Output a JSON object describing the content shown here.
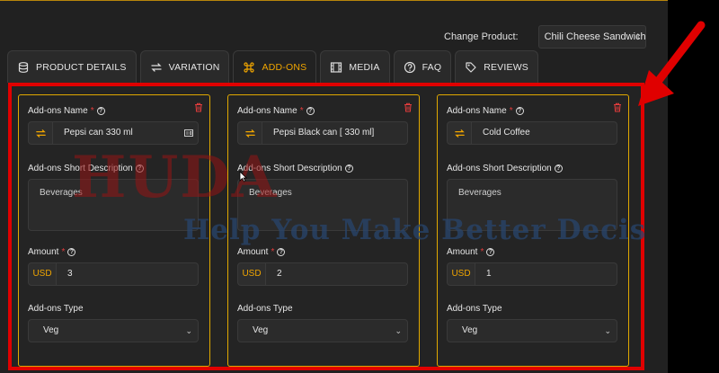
{
  "header": {
    "change_product_label": "Change Product:",
    "selected_product": "Chili Cheese Sandwich"
  },
  "tabs": [
    {
      "label": "PRODUCT DETAILS",
      "icon": "layers-icon",
      "active": false
    },
    {
      "label": "VARIATION",
      "icon": "swap-icon",
      "active": false
    },
    {
      "label": "ADD-ONS",
      "icon": "command-icon",
      "active": true
    },
    {
      "label": "MEDIA",
      "icon": "film-icon",
      "active": false
    },
    {
      "label": "FAQ",
      "icon": "question-icon",
      "active": false
    },
    {
      "label": "REVIEWS",
      "icon": "tag-icon",
      "active": false
    }
  ],
  "labels": {
    "name": "Add-ons Name",
    "required_mark": "*",
    "short_description": "Add-ons Short Description",
    "amount": "Amount",
    "type": "Add-ons Type"
  },
  "addons": [
    {
      "name": "Pepsi can 330 ml",
      "description": "Beverages",
      "currency": "USD",
      "amount": "3",
      "type": "Veg"
    },
    {
      "name": "Pepsi Black can [ 330 ml]",
      "description": "Beverages",
      "currency": "USD",
      "amount": "2",
      "type": "Veg"
    },
    {
      "name": "Cold Coffee",
      "description": "Beverages",
      "currency": "USD",
      "amount": "1",
      "type": "Veg"
    }
  ],
  "watermark": {
    "brand": "HUDA",
    "tagline": "Help You Make Better Decis"
  },
  "colors": {
    "accent": "#f0a500",
    "highlight": "#e00000",
    "card_border": "#e0a800",
    "background": "#212121"
  }
}
